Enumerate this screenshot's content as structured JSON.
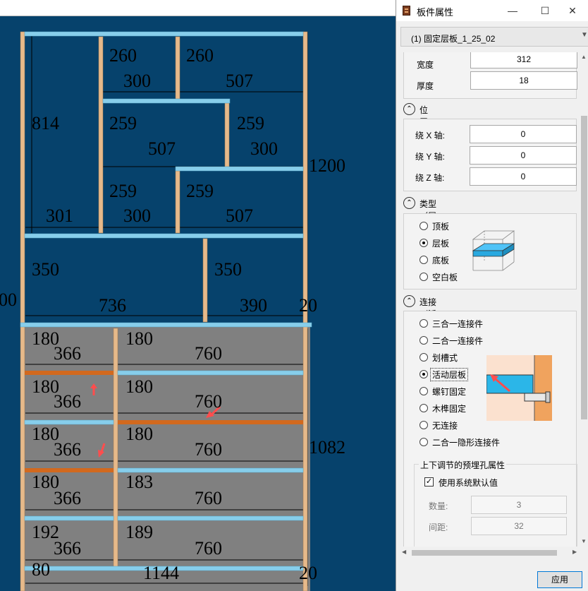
{
  "canvas": {
    "dims": {
      "top_row": [
        "260",
        "260",
        "300",
        "507"
      ],
      "left_height": "814",
      "row2": [
        "259",
        "259",
        "507",
        "300"
      ],
      "row3": [
        "259",
        "259",
        "301",
        "300",
        "507"
      ],
      "right_total": "1200",
      "mid_row": [
        "350",
        "350",
        "736",
        "390",
        "20"
      ],
      "left_edge": "00",
      "lower_rows": [
        [
          "180",
          "180",
          "366",
          "760"
        ],
        [
          "180",
          "180",
          "366",
          "760"
        ],
        [
          "180",
          "180",
          "366",
          "760"
        ],
        [
          "180",
          "183",
          "366",
          "760"
        ],
        [
          "192",
          "189",
          "366",
          "760"
        ]
      ],
      "lower_right": "1082",
      "bottom": [
        "80",
        "1144",
        "20"
      ]
    },
    "colors": {
      "background": "#06426c",
      "lower_panel": "#808080",
      "board_blue": "#87ceeb",
      "board_wood": "#e6b98a",
      "board_orange": "#d2691e",
      "arrow": "#ff4d4d"
    }
  },
  "dialog": {
    "title": "板件属性",
    "window_buttons": [
      "—",
      "☐",
      "✕"
    ],
    "dropdown_value": "(1) 固定层板_1_25_02",
    "size": {
      "width_label": "宽度",
      "width_value": "312",
      "thickness_label": "厚度",
      "thickness_value": "18"
    },
    "position": {
      "header": "位置信息",
      "x_label": "绕 X 轴:",
      "x_value": "0",
      "y_label": "绕 Y 轴:",
      "y_value": "0",
      "z_label": "绕 Z 轴:",
      "z_value": "0"
    },
    "type": {
      "header": "类型 （层板）",
      "options": [
        "顶板",
        "层板",
        "底板",
        "空白板"
      ],
      "selected": "层板"
    },
    "connection": {
      "header": "连接 （活动）",
      "options": [
        "三合一连接件",
        "二合一连接件",
        "划槽式",
        "活动层板",
        "螺钉固定",
        "木榫固定",
        "无连接",
        "二合一隐形连接件"
      ],
      "selected": "活动层板"
    },
    "holes": {
      "group_title": "上下调节的预埋孔属性",
      "use_default_label": "使用系统默认值",
      "use_default_checked": true,
      "count_label": "数量:",
      "count_value": "3",
      "spacing_label": "间距:",
      "spacing_value": "32"
    },
    "collapse_icon": "⌃",
    "apply_label": "应用"
  }
}
